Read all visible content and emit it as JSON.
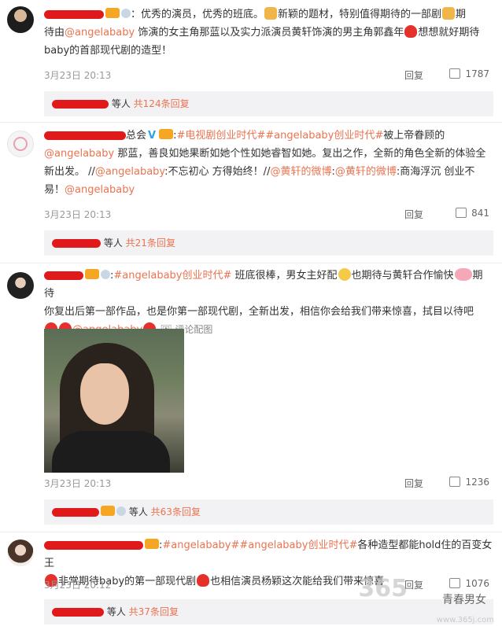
{
  "comments": [
    {
      "text_a": "：优秀的演员，优秀的班底。",
      "text_b": "新颖的题材，特别值得期待的一部剧",
      "text_c": "期",
      "text_d": "待由",
      "mention": "@angelababy",
      "text_e": " 饰演的女主角那蓝以及实力派演员黄轩饰演的男主角郭鑫年",
      "text_f": "想想就好期待",
      "text_g": "baby的首部现代剧的造型！",
      "time": "3月23日 20:13",
      "reply": "回复",
      "likes": "1787",
      "sub_prefix": "等人",
      "sub_count": "共124条回复"
    },
    {
      "name_suffix": "总会",
      "tag1": "#电视剧创业时代#",
      "tag2": "#angelababy创业时代#",
      "text_a": "被上帝眷顾的",
      "mention": "@angelababy",
      "text_b": " 那蓝，善良如她果断如她个性如她睿智如她。复出之作，全新的角色全新的体验全",
      "text_c": "新出发。 //",
      "mention2": "@angelababy",
      "text_d": ":不忘初心 方得始终！//",
      "mention3": "@黄轩的微博",
      "text_e": ":",
      "mention4": "@黄轩的微博",
      "text_f": ":商海浮沉 创业不",
      "text_g": "易！",
      "mention5": "@angelababy",
      "time": "3月23日 20:13",
      "reply": "回复",
      "likes": "841",
      "sub_prefix": "等人",
      "sub_count": "共21条回复"
    },
    {
      "tag": "#angelababy创业时代#",
      "text_a": " 班底很棒，男女主好配",
      "text_b": "也期待与黄轩合作愉快",
      "text_c": "期待",
      "text_d": "你复出后第一部作品，也是你第一部现代剧，全新出发，相信你会给我们带来惊喜，拭目以待吧",
      "mention": "@angelababy",
      "pic_link": "评论配图",
      "time": "3月23日 20:13",
      "reply": "回复",
      "likes": "1236",
      "sub_prefix": "等人",
      "sub_count": "共63条回复"
    },
    {
      "tag1": "#angelababy#",
      "tag2": "#angelababy创业时代#",
      "text_a": "各种造型都能hold住的百变女王",
      "text_b": "非常期待baby的第一部现代剧",
      "text_c": "也相信演员杨颖这次能给我们带来惊喜",
      "time": "3月23日 20:12",
      "reply": "回复",
      "likes": "1076",
      "sub_prefix": "等人",
      "sub_count": "共37条回复"
    }
  ],
  "watermark": {
    "big": "365",
    "brand": "青春男女",
    "url": "www.365j.com"
  }
}
